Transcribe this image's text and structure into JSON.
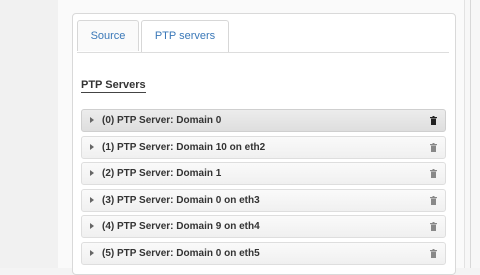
{
  "tabs": [
    {
      "label": "Source"
    },
    {
      "label": "PTP servers"
    }
  ],
  "section": {
    "title": "PTP Servers"
  },
  "servers": [
    {
      "label": "(0) PTP Server: Domain 0"
    },
    {
      "label": "(1) PTP Server: Domain 10 on eth2"
    },
    {
      "label": "(2) PTP Server: Domain 1"
    },
    {
      "label": "(3) PTP Server: Domain 0 on eth3"
    },
    {
      "label": "(4) PTP Server: Domain 9 on eth4"
    },
    {
      "label": "(5) PTP Server: Domain 0 on eth5"
    }
  ],
  "icons": {
    "expand": "caret-right-icon",
    "delete": "trash-icon"
  },
  "colors": {
    "tab_text": "#3a78b8",
    "text": "#333333"
  }
}
